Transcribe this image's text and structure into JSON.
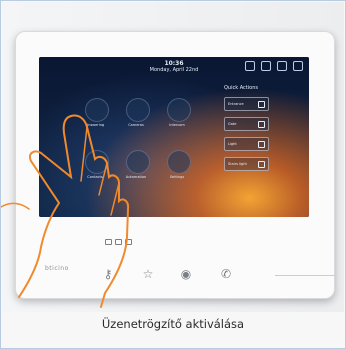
{
  "caption": "Üzenetrögzítő aktiválása",
  "screen": {
    "time": "10:36",
    "date": "Monday, April 22nd",
    "apps": [
      {
        "label": "Answering"
      },
      {
        "label": "Cameras"
      },
      {
        "label": "Intercom"
      },
      {
        "label": "Contacts"
      },
      {
        "label": "Automation"
      },
      {
        "label": "Settings"
      }
    ],
    "quick_actions": {
      "title": "Quick Actions",
      "items": [
        {
          "label": "Entrance"
        },
        {
          "label": "Gate"
        },
        {
          "label": "Light"
        },
        {
          "label": "Stairs light"
        }
      ]
    }
  },
  "device": {
    "brand": "bticino",
    "controls": [
      "key",
      "star",
      "eye",
      "phone"
    ]
  },
  "colors": {
    "frame_border": "#b9cbe0",
    "screen_bg": "#0b1f3a",
    "accent_orange": "#f08a2c"
  }
}
